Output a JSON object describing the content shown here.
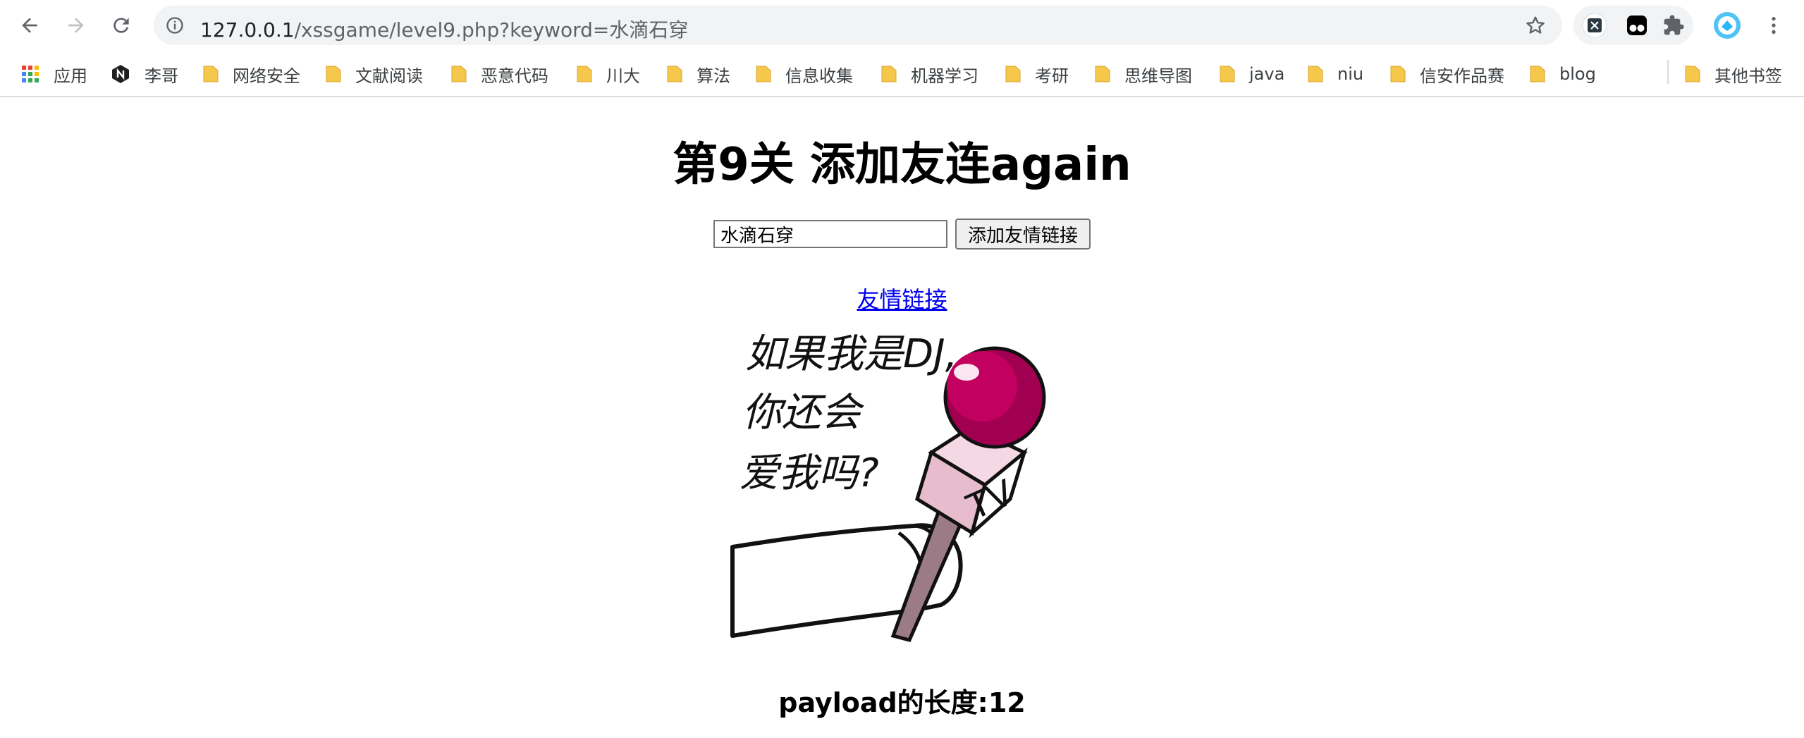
{
  "browser": {
    "url_host": "127.0.0.1",
    "url_path": "/xssgame/level9.php?keyword=水滴石穿",
    "bookmarks": [
      {
        "label": "应用",
        "icon": "apps-grid-icon"
      },
      {
        "label": "李哥",
        "icon": "n-logo-icon"
      },
      {
        "label": "网络安全",
        "icon": "folder-icon"
      },
      {
        "label": "文献阅读",
        "icon": "folder-icon"
      },
      {
        "label": "恶意代码",
        "icon": "folder-icon"
      },
      {
        "label": "川大",
        "icon": "folder-icon"
      },
      {
        "label": "算法",
        "icon": "folder-icon"
      },
      {
        "label": "信息收集",
        "icon": "folder-icon"
      },
      {
        "label": "机器学习",
        "icon": "folder-icon"
      },
      {
        "label": "考研",
        "icon": "folder-icon"
      },
      {
        "label": "思维导图",
        "icon": "folder-icon"
      },
      {
        "label": "java",
        "icon": "folder-icon"
      },
      {
        "label": "niu",
        "icon": "folder-icon"
      },
      {
        "label": "信安作品赛",
        "icon": "folder-icon"
      },
      {
        "label": "blog",
        "icon": "folder-icon"
      }
    ],
    "other_bookmarks": "其他书签"
  },
  "page": {
    "title": "第9关 添加友连again",
    "keyword_value": "水滴石穿",
    "submit_label": "添加友情链接",
    "friend_link_label": "友情链接",
    "meme_text": [
      "如果我是DJ,",
      "你还会",
      "爱我吗?"
    ],
    "mic_label": "TV",
    "payload_length": "payload的长度:12"
  },
  "colors": {
    "link": "#0000ee",
    "folder": "#f5c84c",
    "mic_ball": "#a0004f"
  }
}
